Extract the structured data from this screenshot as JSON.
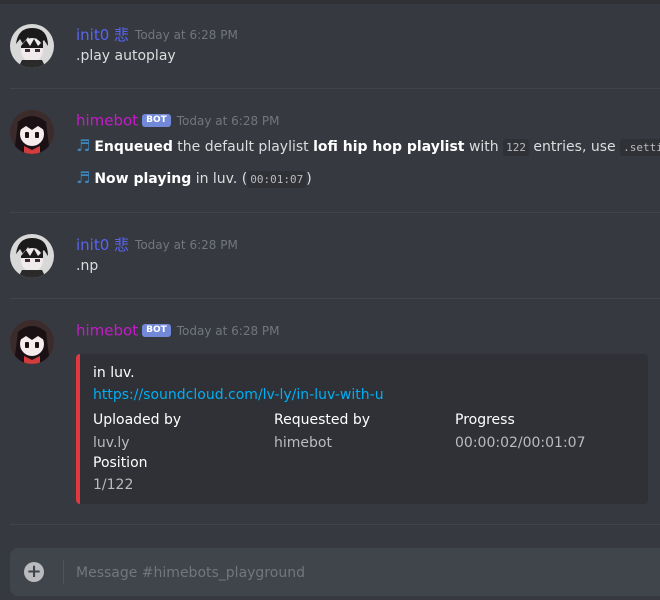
{
  "messages": [
    {
      "author": "init0 悲",
      "timestamp": "Today at 6:28 PM",
      "text": ".play autoplay"
    },
    {
      "author": "himebot",
      "bot_tag": "BOT",
      "timestamp": "Today at 6:28 PM",
      "line1": {
        "bold": "Enqueued",
        "t1": " the default playlist ",
        "playlist": "lofi hip hop playlist",
        "t2": " with ",
        "count": "122",
        "t3": " entries,  use ",
        "cmd": ".settin"
      },
      "line2": {
        "bold": "Now playing",
        "t1": " in luv. (",
        "duration": "00:01:07",
        "t2": ")"
      }
    },
    {
      "author": "init0 悲",
      "timestamp": "Today at 6:28 PM",
      "text": ".np"
    },
    {
      "author": "himebot",
      "bot_tag": "BOT",
      "timestamp": "Today at 6:28 PM",
      "embed": {
        "title": "in luv.",
        "url": "https://soundcloud.com/lv-ly/in-luv-with-u",
        "fields": [
          {
            "name": "Uploaded by",
            "value": "luv.ly"
          },
          {
            "name": "Requested by",
            "value": "himebot"
          },
          {
            "name": "Progress",
            "value": "00:00:02/00:01:07"
          },
          {
            "name": "Position",
            "value": "1/122"
          }
        ],
        "accent_color": "#e0383e"
      }
    }
  ],
  "composer": {
    "placeholder": "Message #himebots_playground"
  },
  "colors": {
    "background": "#36393f",
    "init0_name": "#5865f2",
    "himebot_name": "#c41cc8",
    "link": "#00aff4",
    "bot_tag": "#7289da"
  },
  "icons": [
    "user-avatar",
    "bot-avatar",
    "musical-notes-icon",
    "add-plus-icon"
  ]
}
